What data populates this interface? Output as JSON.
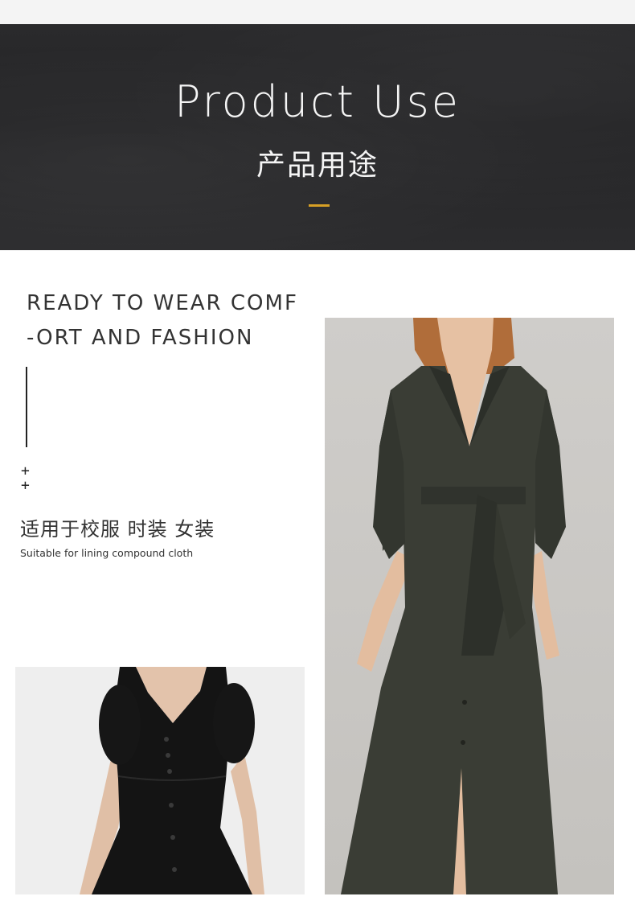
{
  "banner": {
    "title": "Product Use",
    "subtitle": "产品用途",
    "accent_color": "#d7a025",
    "background_color": "#262628"
  },
  "intro": {
    "headline_line1": "READY TO WEAR COMF",
    "headline_line2": "-ORT AND FASHION",
    "plus_1": "+",
    "plus_2": "+",
    "usage_cn": "适用于校服 时装 女装",
    "usage_en": "Suitable for lining compound cloth"
  },
  "images": {
    "left": "black-button-dress-photo",
    "right": "olive-wrap-dress-photo"
  }
}
